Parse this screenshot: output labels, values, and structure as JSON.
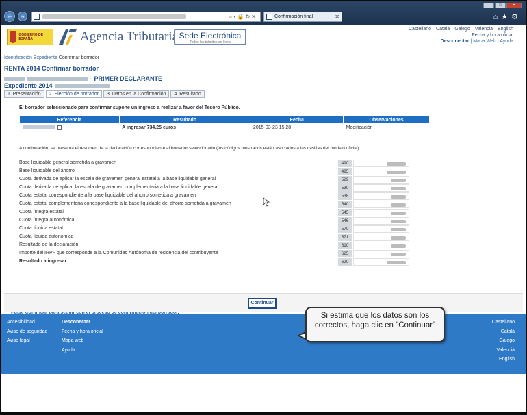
{
  "browser": {
    "tab_title": "Confirmación final",
    "right_icons": "⌂★⚙"
  },
  "header": {
    "crest_text": "GOBIERNO DE ESPAÑA",
    "agency_name": "Agencia Tributaria",
    "sede_title": "Sede Electrónica",
    "sede_subtitle": "Todos los trámites en línea",
    "languages": [
      "Castellano",
      "Català",
      "Galego",
      "Valencià",
      "English"
    ],
    "fecha_link": "Fecha y hora oficial",
    "desconectar": "Desconectar",
    "mapa_web": "Mapa Web",
    "ayuda": "Ayuda"
  },
  "breadcrumb": {
    "link": "Identificación Expediente",
    "current": "Confirmar borrador"
  },
  "page": {
    "title": "RENTA 2014 Confirmar borrador",
    "declarante_suffix": "- PRIMER DECLARANTE",
    "expediente_label": "Expediente 2014"
  },
  "tabs": [
    "1. Presentación",
    "2. Elección de borrador",
    "3. Datos en la Confirmación",
    "4. Resultado"
  ],
  "intro_text": "El borrador seleccionado para confirmar supone un ingreso a realizar a favor del Tesoro Público.",
  "result_table": {
    "headers": [
      "Referencia",
      "Resultado",
      "Fecha",
      "Observaciones"
    ],
    "row": {
      "resultado": "A ingresar 734,25 euros",
      "fecha": "2015-03-23 15:28",
      "observaciones": "Modificación"
    }
  },
  "resumen_text": "A continuación, se presenta el resumen de la declaración correspondiente al borrador seleccionado (los códigos mostrados están asociados a las casillas del modelo oficial):",
  "lines": [
    {
      "label": "Base liquidable general sometida a gravamen",
      "code": "490"
    },
    {
      "label": "Base liquidable del ahorro",
      "code": "495"
    },
    {
      "label": "Cuota derivada de aplicar la escala de gravamen general estatal a la base liquidable general",
      "code": "529"
    },
    {
      "label": "Cuota derivada de aplicar la escala de gravamen complementaria a la base liquidable general",
      "code": "530"
    },
    {
      "label": "Cuota estatal correspondiente a la base liquidable del ahorro sometida a gravamen",
      "code": "538"
    },
    {
      "label": "Cuota estatal complementaria correspondiente a la base liquidable del ahorro sometida a gravamen",
      "code": "540"
    },
    {
      "label": "Cuota íntegra estatal",
      "code": "545"
    },
    {
      "label": "Cuota íntegra autonómica",
      "code": "546"
    },
    {
      "label": "Cuota líquida estatal",
      "code": "570"
    },
    {
      "label": "Cuota líquida autonómica",
      "code": "571"
    },
    {
      "label": "Resultado de la declaración",
      "code": "610"
    },
    {
      "label": "Importe del IRPF que corresponde a la Comunidad Autónoma de residencia del contribuyente",
      "code": "625"
    },
    {
      "label": "Resultado a ingresar",
      "code": "620"
    }
  ],
  "pulse_text": "Pulse Continuar para seguir con el proceso de confirmación del borrador.",
  "continuar_label": "Continuar",
  "footer": {
    "col1": [
      "Accesibilidad",
      "Aviso de seguridad",
      "Aviso legal"
    ],
    "col2": [
      "Desconectar",
      "Fecha y hora oficial",
      "Mapa web",
      "Ayuda"
    ],
    "col3": [
      "Castellano",
      "Català",
      "Galego",
      "Valencià",
      "English"
    ]
  },
  "callout": "Si estima que los datos son los correctos, haga clic en \"Continuar\"",
  "colors": {
    "table_header": "#1e6fc3",
    "footer": "#2f7ac6",
    "title": "#1e4b86"
  }
}
